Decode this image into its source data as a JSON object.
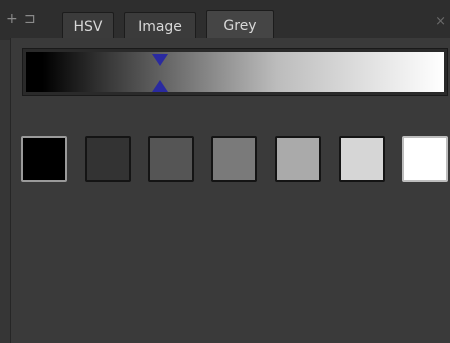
{
  "tabbar": {
    "controls": [
      "+",
      "⊐"
    ],
    "tabs": [
      {
        "label": "HSV",
        "active": false
      },
      {
        "label": "Image",
        "active": false
      },
      {
        "label": "Grey",
        "active": true
      }
    ],
    "close_label": "×"
  },
  "gradient": {
    "colors": [
      "#000000",
      "#ffffff"
    ],
    "marker_value": 0.33
  },
  "swatches": [
    {
      "color": "#000000"
    },
    {
      "color": "#333333"
    },
    {
      "color": "#555555"
    },
    {
      "color": "#7a7a7a"
    },
    {
      "color": "#aaaaaa"
    },
    {
      "color": "#d6d6d6"
    },
    {
      "color": "#ffffff"
    }
  ]
}
